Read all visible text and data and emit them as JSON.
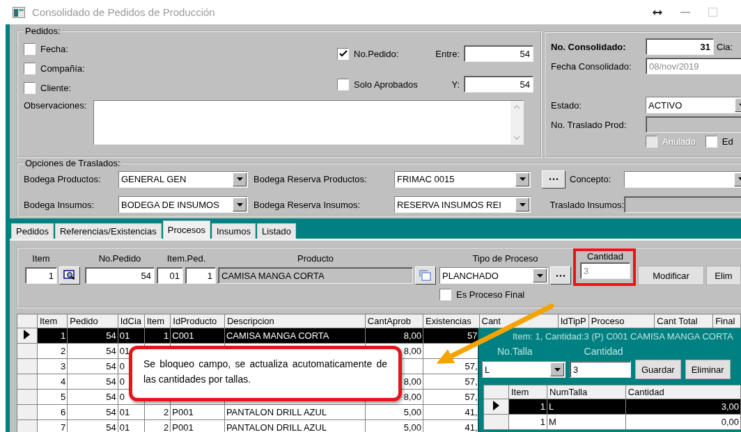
{
  "window": {
    "title": "Consolidado de Pedidos de Producción"
  },
  "pedidos": {
    "title": "Pedidos:",
    "filters": [
      {
        "label": "Fecha:",
        "checked": false
      },
      {
        "label": "Compañía:",
        "checked": false
      },
      {
        "label": "Cliente:",
        "checked": false
      }
    ],
    "no_pedido": {
      "label": "No.Pedido:",
      "checked": true,
      "from_label": "Entre:",
      "from": "54",
      "to_label": "Y:",
      "to": "54"
    },
    "solo_aprobados": {
      "label": "Solo Aprobados",
      "checked": false
    },
    "observaciones_label": "Observaciones:"
  },
  "consolidado": {
    "number_label": "No. Consolidado:",
    "number": "31",
    "cia_label": "Cia:",
    "fecha_label": "Fecha Consolidado:",
    "fecha": "08/nov/2019",
    "estado_label": "Estado:",
    "estado": "ACTIVO",
    "traslado_label": "No. Traslado Prod:",
    "checks": [
      {
        "label": "Anulado",
        "checked": false,
        "disabled": true
      },
      {
        "label": "Ed",
        "checked": false,
        "disabled": false
      }
    ]
  },
  "traslados": {
    "title": "Opciones de Traslados:",
    "bodega_productos": {
      "label": "Bodega Productos:",
      "value": "GENERAL GEN"
    },
    "reserva_productos": {
      "label": "Bodega Reserva Productos:",
      "value": "FRIMAC 0015"
    },
    "concepto_label": "Concepto:",
    "bodega_insumos": {
      "label": "Bodega Insumos:",
      "value": "BODEGA DE INSUMOS"
    },
    "reserva_insumos": {
      "label": "Bodega Reserva Insumos:",
      "value": "RESERVA INSUMOS REI"
    },
    "traslado_insumos_label": "Traslado Insumos:"
  },
  "tabs": [
    {
      "label": "Pedidos",
      "selected": false
    },
    {
      "label": "Referencias/Existencias",
      "selected": false
    },
    {
      "label": "Procesos",
      "selected": true
    },
    {
      "label": "Insumos",
      "selected": false
    },
    {
      "label": "Listado",
      "selected": false
    }
  ],
  "proceso": {
    "item_label": "Item",
    "item": "1",
    "pedido_label": "No.Pedido",
    "pedido": "54",
    "item_ped_label": "Item.Ped.",
    "cia": "01",
    "item_ped": "1",
    "producto_label": "Producto",
    "producto": "CAMISA MANGA CORTA",
    "tipo_label": "Tipo de Proceso",
    "tipo": "PLANCHADO",
    "cantidad_label": "Cantidad",
    "cantidad": "3",
    "cantidad_disabled": true,
    "buttons": [
      "Modificar",
      "Elim"
    ],
    "final": {
      "label": "Es Proceso Final",
      "checked": false
    }
  },
  "grid": {
    "columns": [
      "Item",
      "Pedido",
      "IdCia",
      "Item",
      "IdProducto",
      "Descripcion",
      "CantAprob",
      "Existencias",
      "Cant",
      "IdTipP",
      "Proceso",
      "Cant  Total",
      "Final"
    ],
    "rows": [
      {
        "selected": true,
        "cells": [
          "1",
          "54",
          "01",
          "1",
          "C001",
          "CAMISA MANGA CORTA",
          "8,00",
          "57"
        ]
      },
      {
        "selected": false,
        "cells": [
          "2",
          "54",
          "01",
          null,
          null,
          null,
          "8,00",
          null
        ]
      },
      {
        "selected": false,
        "cells": [
          "3",
          "54",
          "0",
          null,
          null,
          null,
          null,
          "57,"
        ]
      },
      {
        "selected": false,
        "cells": [
          "4",
          "54",
          "0",
          null,
          null,
          null,
          "8,00",
          "57,"
        ]
      },
      {
        "selected": false,
        "cells": [
          "5",
          "54",
          "0",
          null,
          null,
          null,
          "8,00",
          "57,"
        ]
      },
      {
        "selected": false,
        "cells": [
          "6",
          "54",
          "01",
          "2",
          "P001",
          "PANTALON DRILL AZUL",
          "5,00",
          "41,"
        ]
      },
      {
        "selected": false,
        "cells": [
          "7",
          "54",
          "01",
          "2",
          "P001",
          "PANTALON DRILL AZUL",
          "5,00",
          "41,"
        ]
      }
    ]
  },
  "popup": {
    "title": "Item: 1, Cantidad:3 (P) C001 CAMISA MANGA CORTA",
    "talla_label": "No.Talla",
    "cantidad_label": "Cantidad",
    "talla": "L",
    "cantidad": "3",
    "buttons": [
      "Guardar",
      "Eliminar"
    ],
    "columns": [
      "Item",
      "NumTalla",
      "Cantidad"
    ],
    "rows": [
      {
        "selected": true,
        "cells": [
          "1",
          "L",
          "3,00"
        ]
      },
      {
        "selected": false,
        "cells": [
          "1",
          "M",
          "0,00"
        ]
      }
    ]
  },
  "callout": {
    "text": "Se bloqueo campo, se actualiza acutomaticamente de las cantidades por tallas."
  }
}
